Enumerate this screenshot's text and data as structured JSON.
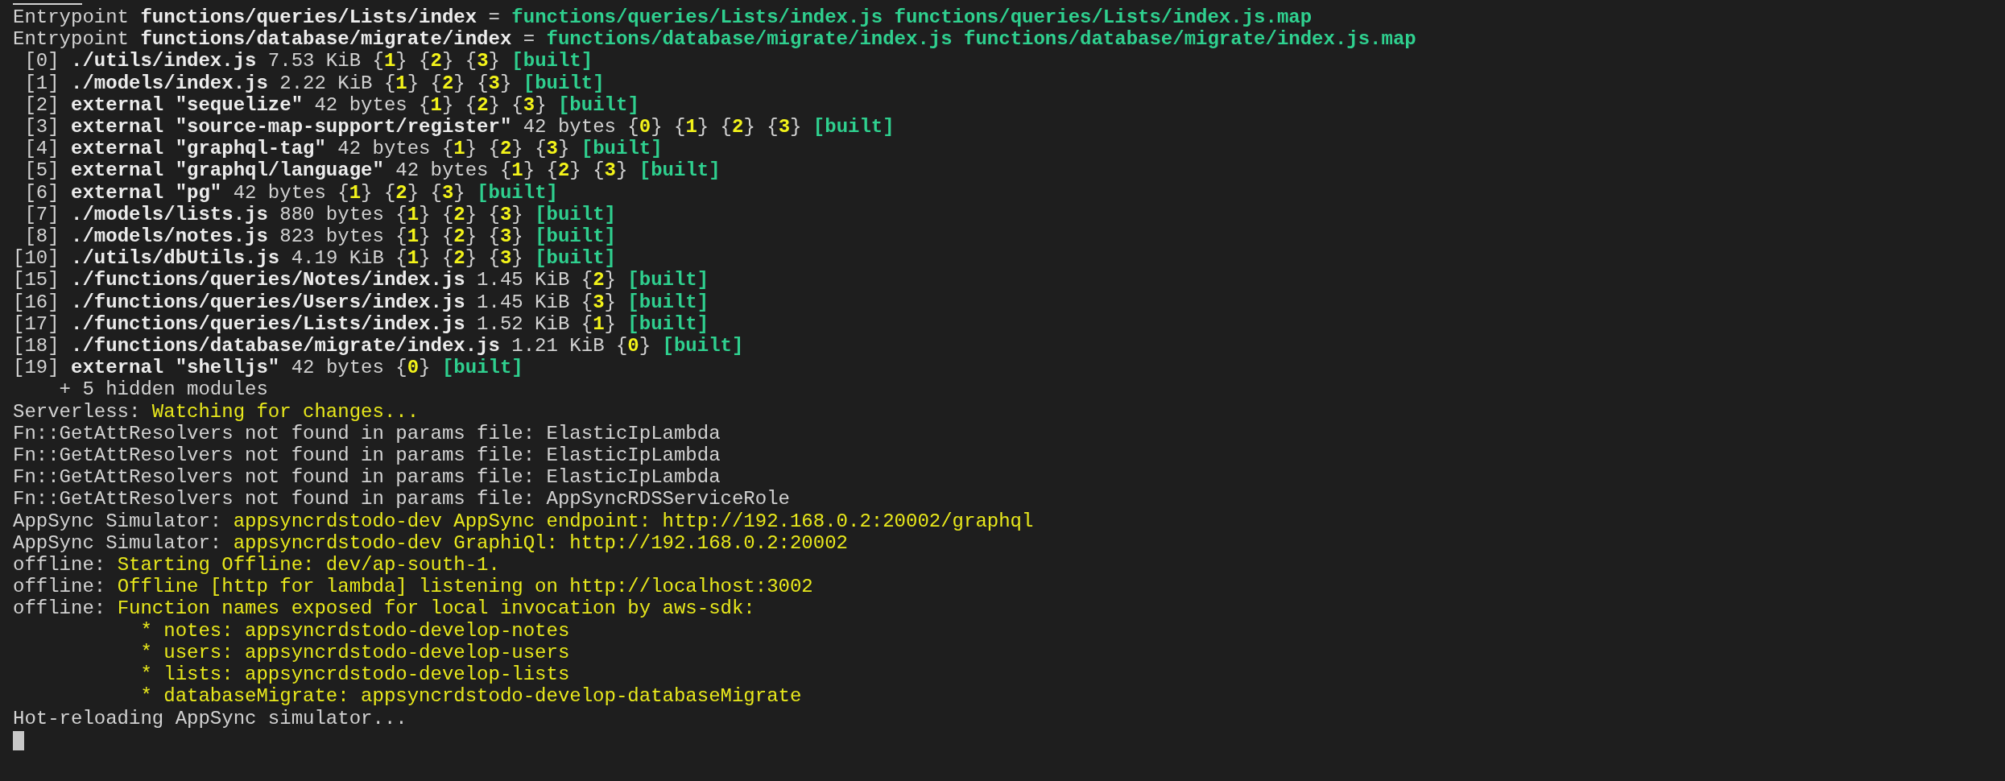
{
  "terminal": {
    "lines": [
      {
        "segments": [
          {
            "text": "Entrypoint ",
            "kind": "plain"
          },
          {
            "text": "functions/queries/Lists/index",
            "kind": "bold"
          },
          {
            "text": " = ",
            "kind": "plain"
          },
          {
            "text": "functions/queries/Lists/index.js functions/queries/Lists/index.js.map",
            "kind": "green"
          }
        ]
      },
      {
        "segments": [
          {
            "text": "Entrypoint ",
            "kind": "plain"
          },
          {
            "text": "functions/database/migrate/index",
            "kind": "bold"
          },
          {
            "text": " = ",
            "kind": "plain"
          },
          {
            "text": "functions/database/migrate/index.js functions/database/migrate/index.js.map",
            "kind": "green"
          }
        ]
      },
      {
        "segments": [
          {
            "text": " [0] ",
            "kind": "plain"
          },
          {
            "text": "./utils/index.js",
            "kind": "bold"
          },
          {
            "text": " 7.53 KiB {",
            "kind": "plain"
          },
          {
            "text": "1",
            "kind": "num"
          },
          {
            "text": "} {",
            "kind": "plain"
          },
          {
            "text": "2",
            "kind": "num"
          },
          {
            "text": "} {",
            "kind": "plain"
          },
          {
            "text": "3",
            "kind": "num"
          },
          {
            "text": "} ",
            "kind": "plain"
          },
          {
            "text": "[built]",
            "kind": "green"
          }
        ]
      },
      {
        "segments": [
          {
            "text": " [1] ",
            "kind": "plain"
          },
          {
            "text": "./models/index.js",
            "kind": "bold"
          },
          {
            "text": " 2.22 KiB {",
            "kind": "plain"
          },
          {
            "text": "1",
            "kind": "num"
          },
          {
            "text": "} {",
            "kind": "plain"
          },
          {
            "text": "2",
            "kind": "num"
          },
          {
            "text": "} {",
            "kind": "plain"
          },
          {
            "text": "3",
            "kind": "num"
          },
          {
            "text": "} ",
            "kind": "plain"
          },
          {
            "text": "[built]",
            "kind": "green"
          }
        ]
      },
      {
        "segments": [
          {
            "text": " [2] ",
            "kind": "plain"
          },
          {
            "text": "external \"sequelize\"",
            "kind": "bold"
          },
          {
            "text": " 42 bytes {",
            "kind": "plain"
          },
          {
            "text": "1",
            "kind": "num"
          },
          {
            "text": "} {",
            "kind": "plain"
          },
          {
            "text": "2",
            "kind": "num"
          },
          {
            "text": "} {",
            "kind": "plain"
          },
          {
            "text": "3",
            "kind": "num"
          },
          {
            "text": "} ",
            "kind": "plain"
          },
          {
            "text": "[built]",
            "kind": "green"
          }
        ]
      },
      {
        "segments": [
          {
            "text": " [3] ",
            "kind": "plain"
          },
          {
            "text": "external \"source-map-support/register\"",
            "kind": "bold"
          },
          {
            "text": " 42 bytes {",
            "kind": "plain"
          },
          {
            "text": "0",
            "kind": "num"
          },
          {
            "text": "} {",
            "kind": "plain"
          },
          {
            "text": "1",
            "kind": "num"
          },
          {
            "text": "} {",
            "kind": "plain"
          },
          {
            "text": "2",
            "kind": "num"
          },
          {
            "text": "} {",
            "kind": "plain"
          },
          {
            "text": "3",
            "kind": "num"
          },
          {
            "text": "} ",
            "kind": "plain"
          },
          {
            "text": "[built]",
            "kind": "green"
          }
        ]
      },
      {
        "segments": [
          {
            "text": " [4] ",
            "kind": "plain"
          },
          {
            "text": "external \"graphql-tag\"",
            "kind": "bold"
          },
          {
            "text": " 42 bytes {",
            "kind": "plain"
          },
          {
            "text": "1",
            "kind": "num"
          },
          {
            "text": "} {",
            "kind": "plain"
          },
          {
            "text": "2",
            "kind": "num"
          },
          {
            "text": "} {",
            "kind": "plain"
          },
          {
            "text": "3",
            "kind": "num"
          },
          {
            "text": "} ",
            "kind": "plain"
          },
          {
            "text": "[built]",
            "kind": "green"
          }
        ]
      },
      {
        "segments": [
          {
            "text": " [5] ",
            "kind": "plain"
          },
          {
            "text": "external \"graphql/language\"",
            "kind": "bold"
          },
          {
            "text": " 42 bytes {",
            "kind": "plain"
          },
          {
            "text": "1",
            "kind": "num"
          },
          {
            "text": "} {",
            "kind": "plain"
          },
          {
            "text": "2",
            "kind": "num"
          },
          {
            "text": "} {",
            "kind": "plain"
          },
          {
            "text": "3",
            "kind": "num"
          },
          {
            "text": "} ",
            "kind": "plain"
          },
          {
            "text": "[built]",
            "kind": "green"
          }
        ]
      },
      {
        "segments": [
          {
            "text": " [6] ",
            "kind": "plain"
          },
          {
            "text": "external \"pg\"",
            "kind": "bold"
          },
          {
            "text": " 42 bytes {",
            "kind": "plain"
          },
          {
            "text": "1",
            "kind": "num"
          },
          {
            "text": "} {",
            "kind": "plain"
          },
          {
            "text": "2",
            "kind": "num"
          },
          {
            "text": "} {",
            "kind": "plain"
          },
          {
            "text": "3",
            "kind": "num"
          },
          {
            "text": "} ",
            "kind": "plain"
          },
          {
            "text": "[built]",
            "kind": "green"
          }
        ]
      },
      {
        "segments": [
          {
            "text": " [7] ",
            "kind": "plain"
          },
          {
            "text": "./models/lists.js",
            "kind": "bold"
          },
          {
            "text": " 880 bytes {",
            "kind": "plain"
          },
          {
            "text": "1",
            "kind": "num"
          },
          {
            "text": "} {",
            "kind": "plain"
          },
          {
            "text": "2",
            "kind": "num"
          },
          {
            "text": "} {",
            "kind": "plain"
          },
          {
            "text": "3",
            "kind": "num"
          },
          {
            "text": "} ",
            "kind": "plain"
          },
          {
            "text": "[built]",
            "kind": "green"
          }
        ]
      },
      {
        "segments": [
          {
            "text": " [8] ",
            "kind": "plain"
          },
          {
            "text": "./models/notes.js",
            "kind": "bold"
          },
          {
            "text": " 823 bytes {",
            "kind": "plain"
          },
          {
            "text": "1",
            "kind": "num"
          },
          {
            "text": "} {",
            "kind": "plain"
          },
          {
            "text": "2",
            "kind": "num"
          },
          {
            "text": "} {",
            "kind": "plain"
          },
          {
            "text": "3",
            "kind": "num"
          },
          {
            "text": "} ",
            "kind": "plain"
          },
          {
            "text": "[built]",
            "kind": "green"
          }
        ]
      },
      {
        "segments": [
          {
            "text": "[10] ",
            "kind": "plain"
          },
          {
            "text": "./utils/dbUtils.js",
            "kind": "bold"
          },
          {
            "text": " 4.19 KiB {",
            "kind": "plain"
          },
          {
            "text": "1",
            "kind": "num"
          },
          {
            "text": "} {",
            "kind": "plain"
          },
          {
            "text": "2",
            "kind": "num"
          },
          {
            "text": "} {",
            "kind": "plain"
          },
          {
            "text": "3",
            "kind": "num"
          },
          {
            "text": "} ",
            "kind": "plain"
          },
          {
            "text": "[built]",
            "kind": "green"
          }
        ]
      },
      {
        "segments": [
          {
            "text": "[15] ",
            "kind": "plain"
          },
          {
            "text": "./functions/queries/Notes/index.js",
            "kind": "bold"
          },
          {
            "text": " 1.45 KiB {",
            "kind": "plain"
          },
          {
            "text": "2",
            "kind": "num"
          },
          {
            "text": "} ",
            "kind": "plain"
          },
          {
            "text": "[built]",
            "kind": "green"
          }
        ]
      },
      {
        "segments": [
          {
            "text": "[16] ",
            "kind": "plain"
          },
          {
            "text": "./functions/queries/Users/index.js",
            "kind": "bold"
          },
          {
            "text": " 1.45 KiB {",
            "kind": "plain"
          },
          {
            "text": "3",
            "kind": "num"
          },
          {
            "text": "} ",
            "kind": "plain"
          },
          {
            "text": "[built]",
            "kind": "green"
          }
        ]
      },
      {
        "segments": [
          {
            "text": "[17] ",
            "kind": "plain"
          },
          {
            "text": "./functions/queries/Lists/index.js",
            "kind": "bold"
          },
          {
            "text": " 1.52 KiB {",
            "kind": "plain"
          },
          {
            "text": "1",
            "kind": "num"
          },
          {
            "text": "} ",
            "kind": "plain"
          },
          {
            "text": "[built]",
            "kind": "green"
          }
        ]
      },
      {
        "segments": [
          {
            "text": "[18] ",
            "kind": "plain"
          },
          {
            "text": "./functions/database/migrate/index.js",
            "kind": "bold"
          },
          {
            "text": " 1.21 KiB {",
            "kind": "plain"
          },
          {
            "text": "0",
            "kind": "num"
          },
          {
            "text": "} ",
            "kind": "plain"
          },
          {
            "text": "[built]",
            "kind": "green"
          }
        ]
      },
      {
        "segments": [
          {
            "text": "[19] ",
            "kind": "plain"
          },
          {
            "text": "external \"shelljs\"",
            "kind": "bold"
          },
          {
            "text": " 42 bytes {",
            "kind": "plain"
          },
          {
            "text": "0",
            "kind": "num"
          },
          {
            "text": "} ",
            "kind": "plain"
          },
          {
            "text": "[built]",
            "kind": "green"
          }
        ]
      },
      {
        "segments": [
          {
            "text": "    + 5 hidden modules",
            "kind": "plain"
          }
        ]
      },
      {
        "segments": [
          {
            "text": "Serverless: ",
            "kind": "plain"
          },
          {
            "text": "Watching for changes...",
            "kind": "yellow"
          }
        ]
      },
      {
        "segments": [
          {
            "text": "Fn::GetAttResolvers not found in params file: ElasticIpLambda",
            "kind": "plain"
          }
        ]
      },
      {
        "segments": [
          {
            "text": "Fn::GetAttResolvers not found in params file: ElasticIpLambda",
            "kind": "plain"
          }
        ]
      },
      {
        "segments": [
          {
            "text": "Fn::GetAttResolvers not found in params file: ElasticIpLambda",
            "kind": "plain"
          }
        ]
      },
      {
        "segments": [
          {
            "text": "Fn::GetAttResolvers not found in params file: AppSyncRDSServiceRole",
            "kind": "plain"
          }
        ]
      },
      {
        "segments": [
          {
            "text": "AppSync Simulator: ",
            "kind": "plain"
          },
          {
            "text": "appsyncrdstodo-dev AppSync endpoint: http://192.168.0.2:20002/graphql",
            "kind": "yellow"
          }
        ]
      },
      {
        "segments": [
          {
            "text": "AppSync Simulator: ",
            "kind": "plain"
          },
          {
            "text": "appsyncrdstodo-dev GraphiQl: http://192.168.0.2:20002",
            "kind": "yellow"
          }
        ]
      },
      {
        "segments": [
          {
            "text": "offline: ",
            "kind": "plain"
          },
          {
            "text": "Starting Offline: dev/ap-south-1.",
            "kind": "yellow"
          }
        ]
      },
      {
        "segments": [
          {
            "text": "offline: ",
            "kind": "plain"
          },
          {
            "text": "Offline [http for lambda] listening on http://localhost:3002",
            "kind": "yellow"
          }
        ]
      },
      {
        "segments": [
          {
            "text": "offline: ",
            "kind": "plain"
          },
          {
            "text": "Function names exposed for local invocation by aws-sdk:",
            "kind": "yellow"
          }
        ]
      },
      {
        "segments": [
          {
            "text": "           * notes: appsyncrdstodo-develop-notes",
            "kind": "yellow"
          }
        ]
      },
      {
        "segments": [
          {
            "text": "           * users: appsyncrdstodo-develop-users",
            "kind": "yellow"
          }
        ]
      },
      {
        "segments": [
          {
            "text": "           * lists: appsyncrdstodo-develop-lists",
            "kind": "yellow"
          }
        ]
      },
      {
        "segments": [
          {
            "text": "           * databaseMigrate: appsyncrdstodo-develop-databaseMigrate",
            "kind": "yellow"
          }
        ]
      },
      {
        "segments": [
          {
            "text": "Hot-reloading AppSync simulator...",
            "kind": "plain"
          }
        ]
      }
    ]
  }
}
